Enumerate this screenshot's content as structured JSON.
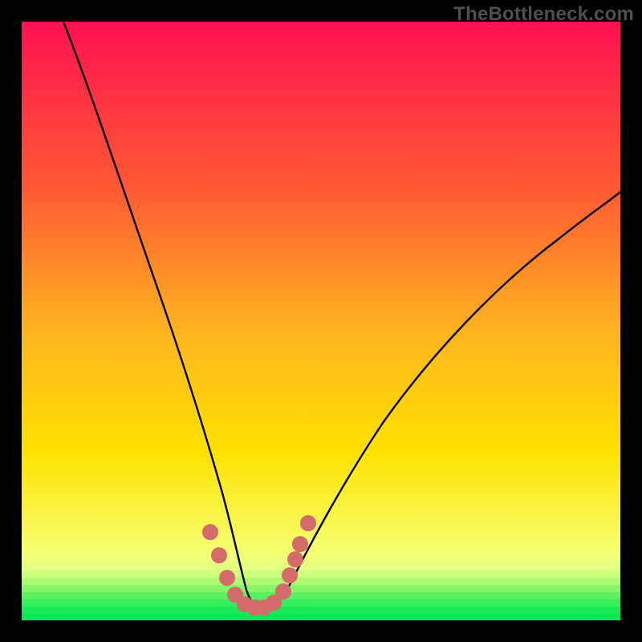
{
  "watermark": "TheBottleneck.com",
  "colors": {
    "frame": "#000000",
    "watermark": "#4f4f4f",
    "curve_stroke": "#000000",
    "dot_fill": "#d46a6a",
    "gradient_top": "#ff1151",
    "gradient_mid": "#ffd400",
    "gradient_green": "#00e852"
  },
  "chart_data": {
    "type": "line",
    "title": "",
    "xlabel": "",
    "ylabel": "",
    "xlim": [
      0,
      100
    ],
    "ylim": [
      0,
      100
    ],
    "series": [
      {
        "name": "bottleneck-curve",
        "x": [
          7,
          10,
          14,
          18,
          22,
          26,
          30,
          32,
          34,
          36,
          38,
          40,
          42,
          46,
          50,
          55,
          60,
          65,
          70,
          78,
          86,
          94,
          100
        ],
        "y": [
          100,
          88,
          74,
          62,
          51,
          40,
          28,
          20,
          12,
          6,
          3,
          2,
          3,
          6,
          11,
          18,
          25,
          32,
          38,
          47,
          55,
          62,
          67
        ]
      }
    ],
    "highlight_points": {
      "name": "highlight-dots",
      "x": [
        31.5,
        33,
        34.5,
        36,
        37.5,
        39,
        40.5,
        42,
        43.5,
        44.5,
        45.3,
        46.2,
        47.5
      ],
      "y": [
        14,
        9,
        5,
        3,
        2,
        2,
        2,
        2.5,
        4.5,
        7,
        9.5,
        12,
        16
      ]
    },
    "heatmap_bands": [
      {
        "y_from": 100,
        "y_to": 60,
        "from_color": "#ff1151",
        "to_color": "#ff8a2a"
      },
      {
        "y_from": 60,
        "y_to": 30,
        "from_color": "#ff8a2a",
        "to_color": "#ffe100"
      },
      {
        "y_from": 30,
        "y_to": 12,
        "from_color": "#ffe100",
        "to_color": "#f3ff6a"
      },
      {
        "y_from": 12,
        "y_to": 4,
        "from_color": "#f3ff6a",
        "to_color": "#9cff66"
      },
      {
        "y_from": 4,
        "y_to": 0,
        "from_color": "#35f56a",
        "to_color": "#00e852"
      }
    ]
  }
}
